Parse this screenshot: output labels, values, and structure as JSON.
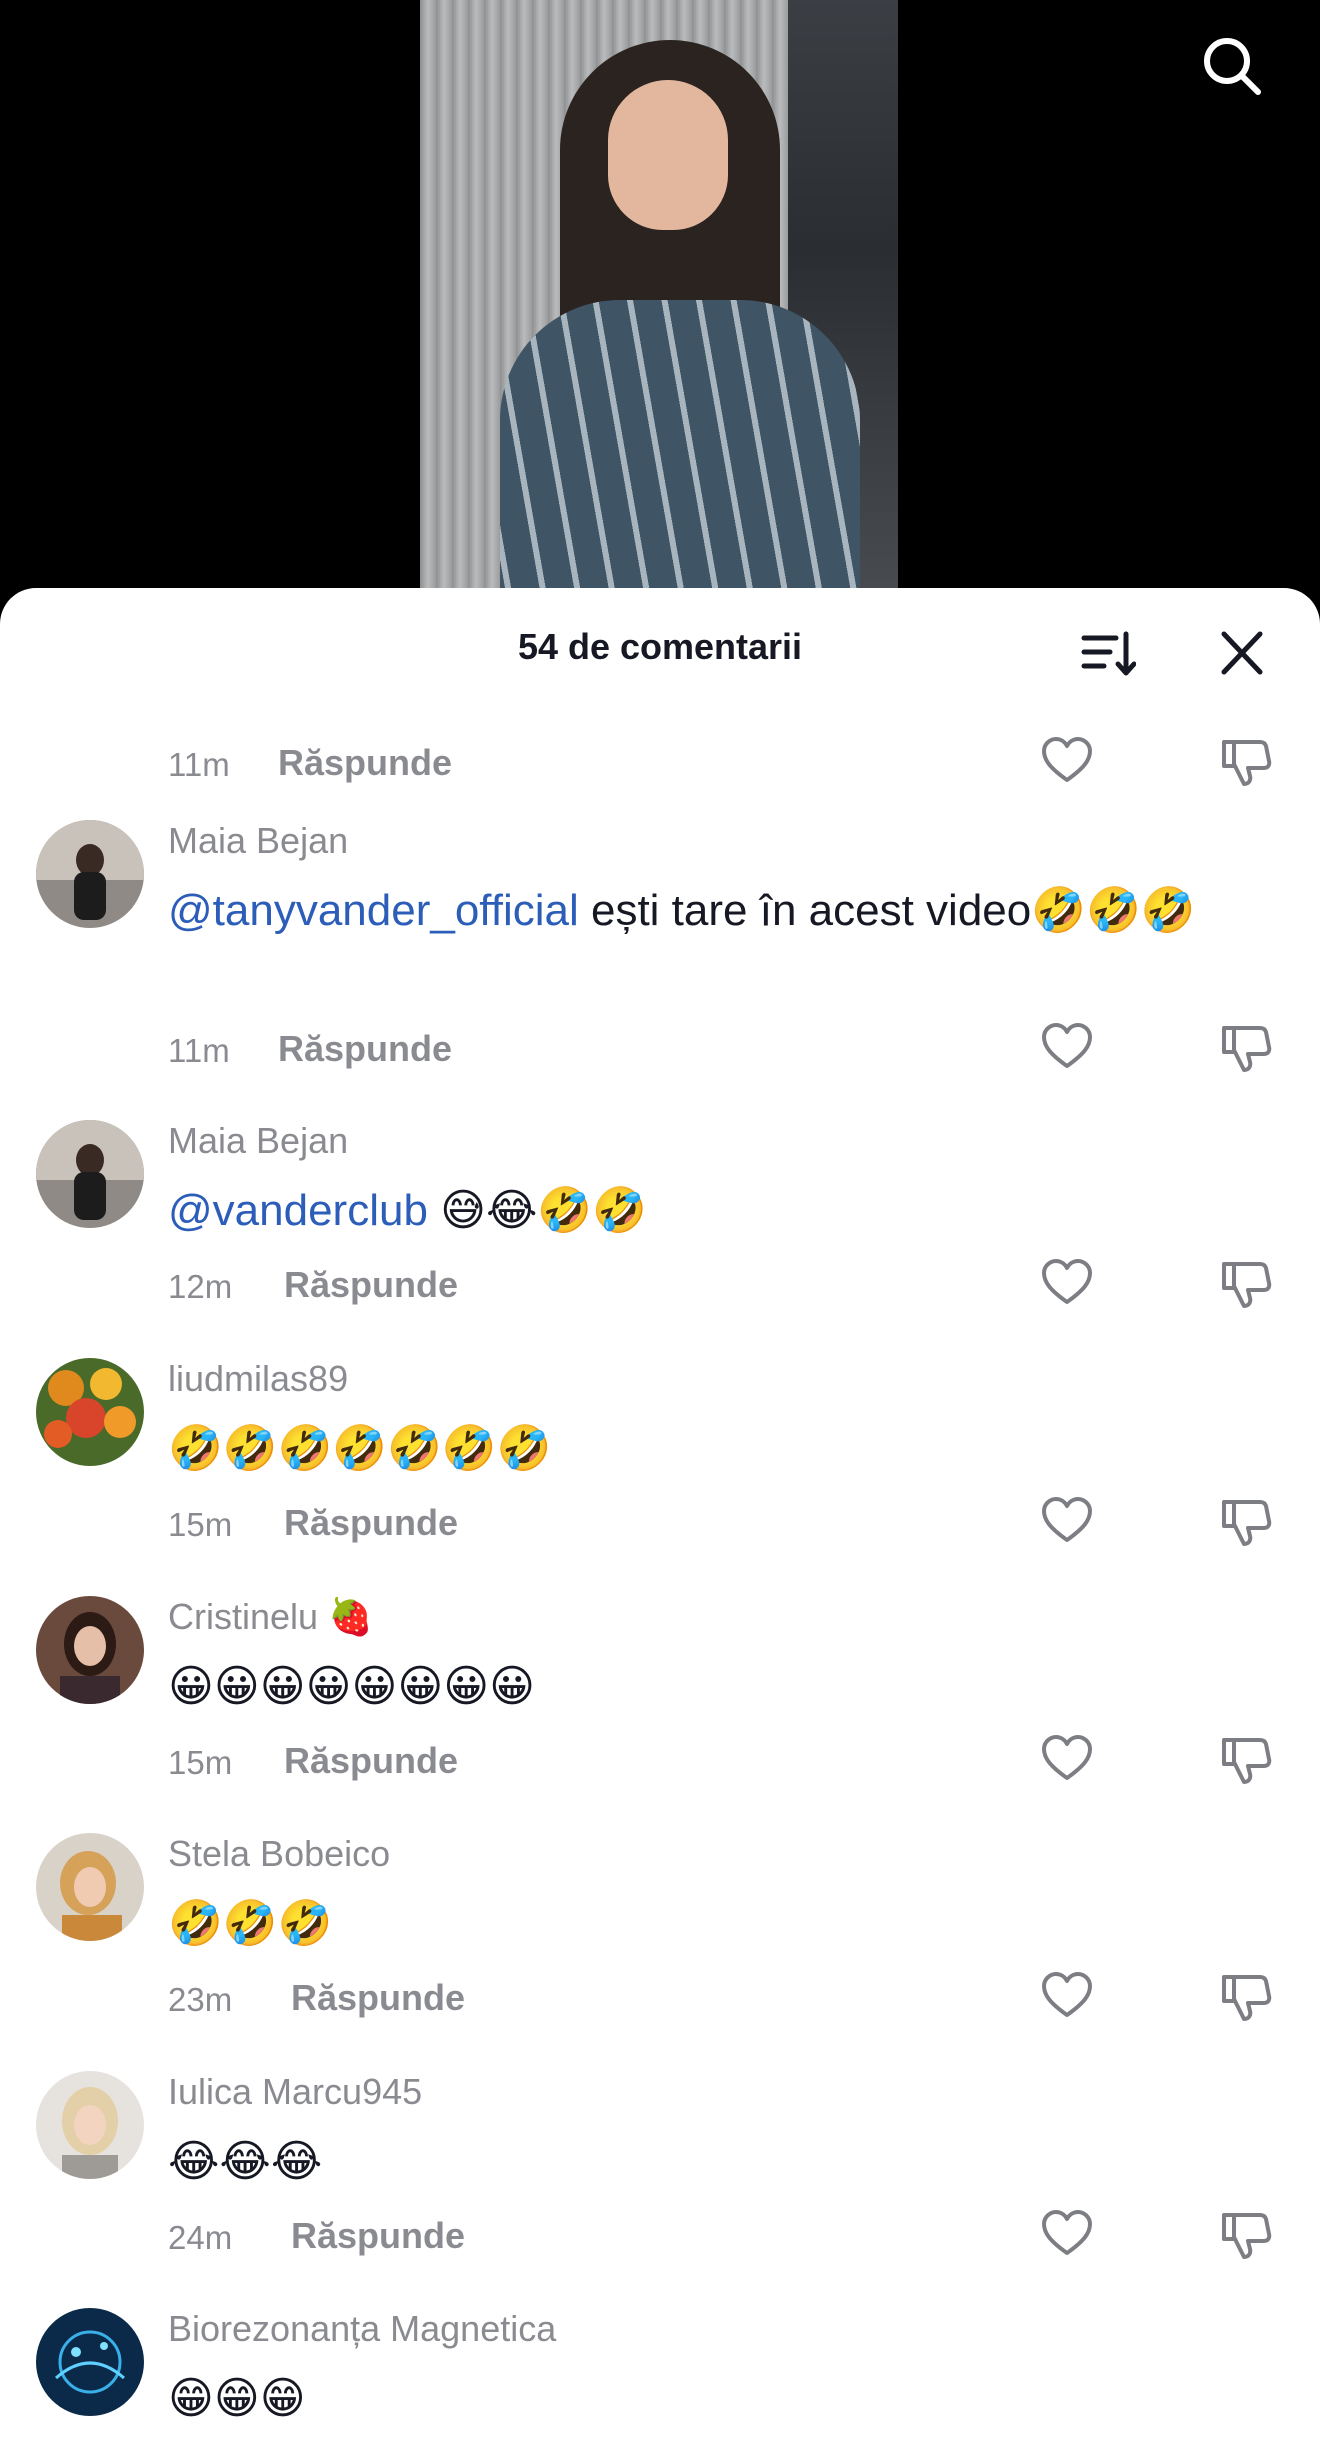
{
  "sheet": {
    "title": "54 de comentarii"
  },
  "first_meta": {
    "time": "11m",
    "reply": "Răspunde"
  },
  "comments": [
    {
      "username": "Maia Bejan",
      "mention": "@tanyvander_official",
      "text": " ești tare în acest video🤣🤣🤣",
      "time": "11m",
      "reply": "Răspunde"
    },
    {
      "username": "Maia Bejan",
      "mention": "@vanderclub",
      "text": " 😅😂🤣🤣",
      "time": "12m",
      "reply": "Răspunde"
    },
    {
      "username": "liudmilas89",
      "mention": "",
      "text": "🤣🤣🤣🤣🤣🤣🤣",
      "time": "15m",
      "reply": "Răspunde"
    },
    {
      "username": "Cristinelu 🍓",
      "mention": "",
      "text": "😀😀😀😀😀😀😀😀",
      "time": "15m",
      "reply": "Răspunde"
    },
    {
      "username": "Stela  Bobeico",
      "mention": "",
      "text": "🤣🤣🤣",
      "time": "23m",
      "reply": "Răspunde"
    },
    {
      "username": "Iulica Marcu945",
      "mention": "",
      "text": "😂😂😂",
      "time": "24m",
      "reply": "Răspunde"
    },
    {
      "username": "Biorezonanța Magnetica",
      "mention": "",
      "text": "😁😁😁",
      "time": "",
      "reply": ""
    }
  ],
  "icons": {
    "search": "search-icon",
    "sort": "sort-icon",
    "close": "close-icon",
    "like": "heart-icon",
    "dislike": "thumbs-down-icon"
  },
  "colors": {
    "mention": "#2b5db9",
    "secondary_text": "#8a8b91",
    "primary_text": "#161823"
  }
}
